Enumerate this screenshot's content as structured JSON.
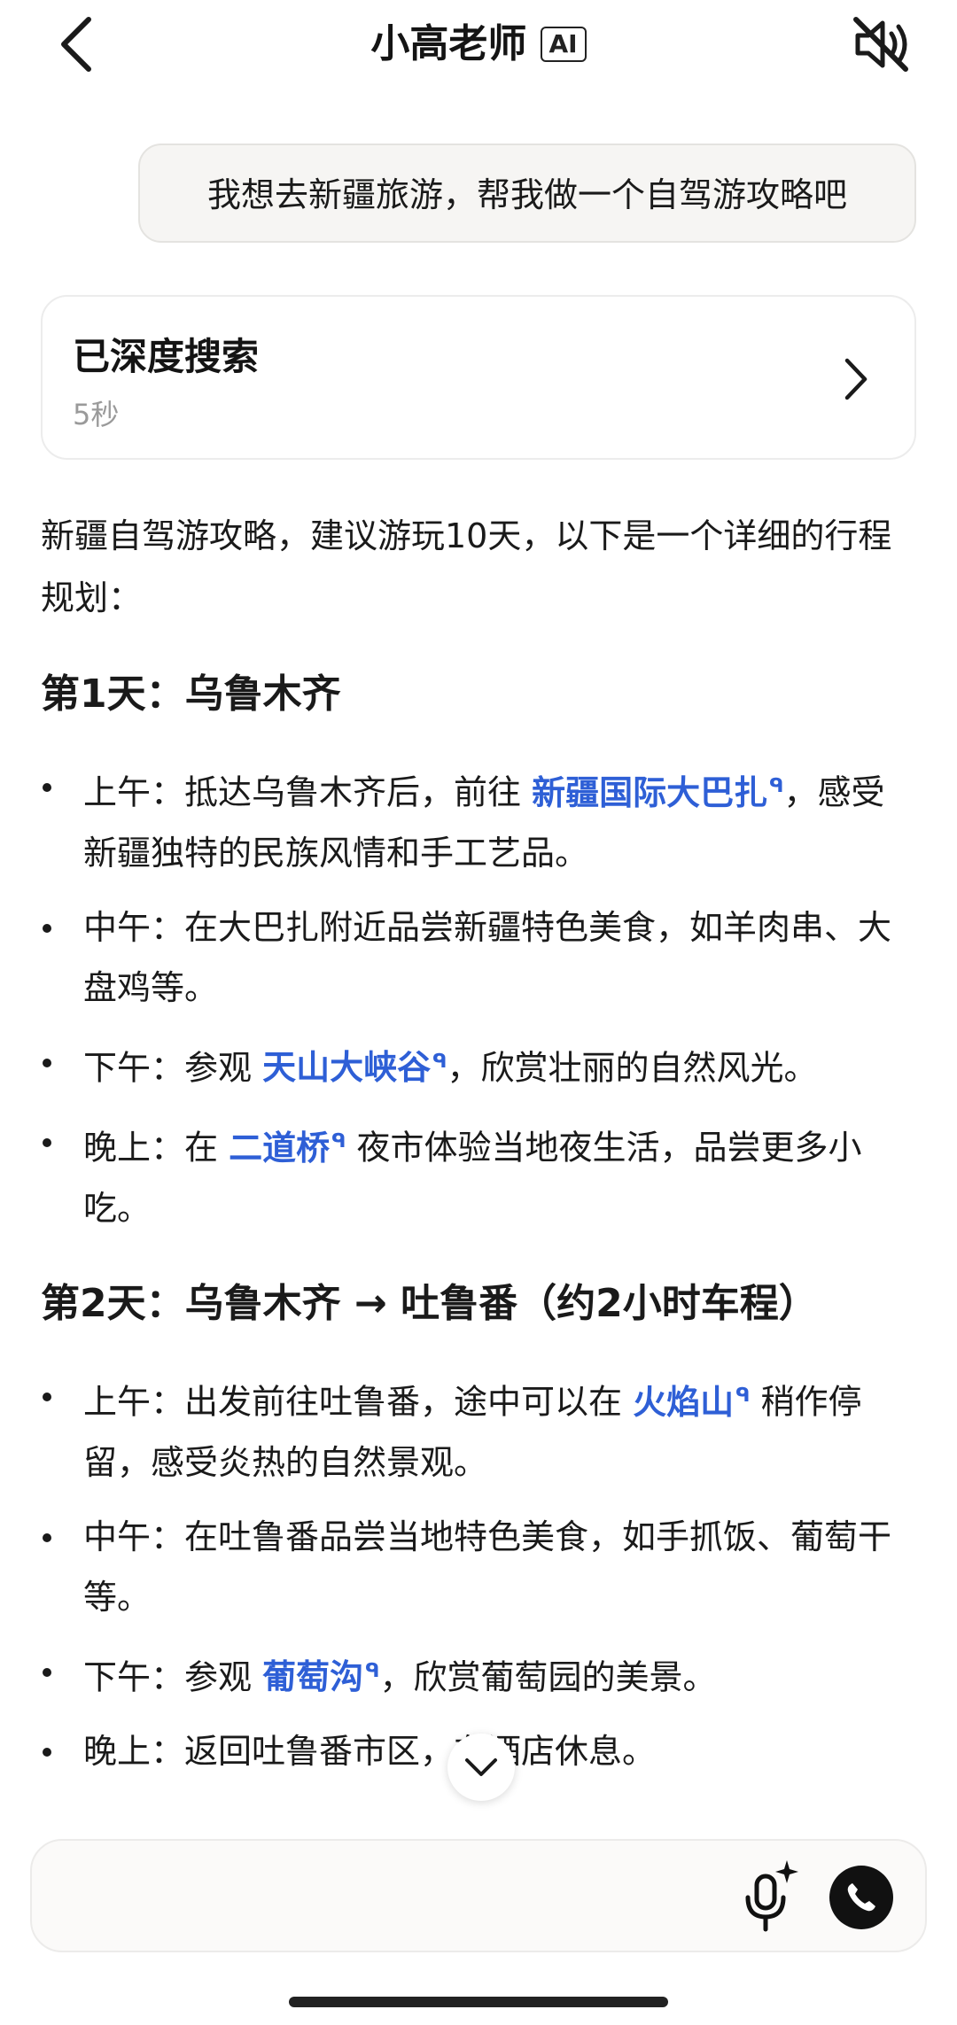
{
  "header": {
    "title": "小高老师",
    "ai_badge": "AI"
  },
  "user_message": "我想去新疆旅游，帮我做一个自驾游攻略吧",
  "search_card": {
    "title": "已深度搜索",
    "duration": "5秒"
  },
  "intro": "新疆自驾游攻略，建议游玩10天，以下是一个详细的行程规划：",
  "days": [
    {
      "title": "第1天：乌鲁木齐",
      "items": [
        {
          "before": "上午：抵达乌鲁木齐后，前往 ",
          "link": "新疆国际大巴扎",
          "after": "，感受新疆独特的民族风情和手工艺品。"
        },
        {
          "before": "中午：在大巴扎附近品尝新疆特色美食，如羊肉串、大盘鸡等。",
          "link": "",
          "after": ""
        },
        {
          "before": "下午：参观 ",
          "link": "天山大峡谷",
          "after": "，欣赏壮丽的自然风光。"
        },
        {
          "before": "晚上：在 ",
          "link": "二道桥",
          "after": " 夜市体验当地夜生活，品尝更多小吃。"
        }
      ]
    },
    {
      "title": "第2天：乌鲁木齐 → 吐鲁番（约2小时车程）",
      "items": [
        {
          "before": "上午：出发前往吐鲁番，途中可以在 ",
          "link": "火焰山",
          "after": " 稍作停留，感受炎热的自然景观。"
        },
        {
          "before": "中午：在吐鲁番品尝当地特色美食，如手抓饭、葡萄干等。",
          "link": "",
          "after": ""
        },
        {
          "before": "下午：参观 ",
          "link": "葡萄沟",
          "after": "，欣赏葡萄园的美景。"
        },
        {
          "before": "晚上：返回吐鲁番市区，",
          "link": "",
          "after": "在酒店休息。"
        }
      ]
    }
  ],
  "colors": {
    "link": "#2e5fd6",
    "text": "#1a1a1a",
    "muted": "#9a9a9a"
  },
  "icons": {
    "back": "chevron-left-icon",
    "mute": "speaker-muted-icon",
    "card_arrow": "chevron-right-icon",
    "scroll": "chevron-down-icon",
    "mic": "sparkle-mic-icon",
    "call": "phone-icon",
    "link_mark": "search-mini-icon"
  }
}
